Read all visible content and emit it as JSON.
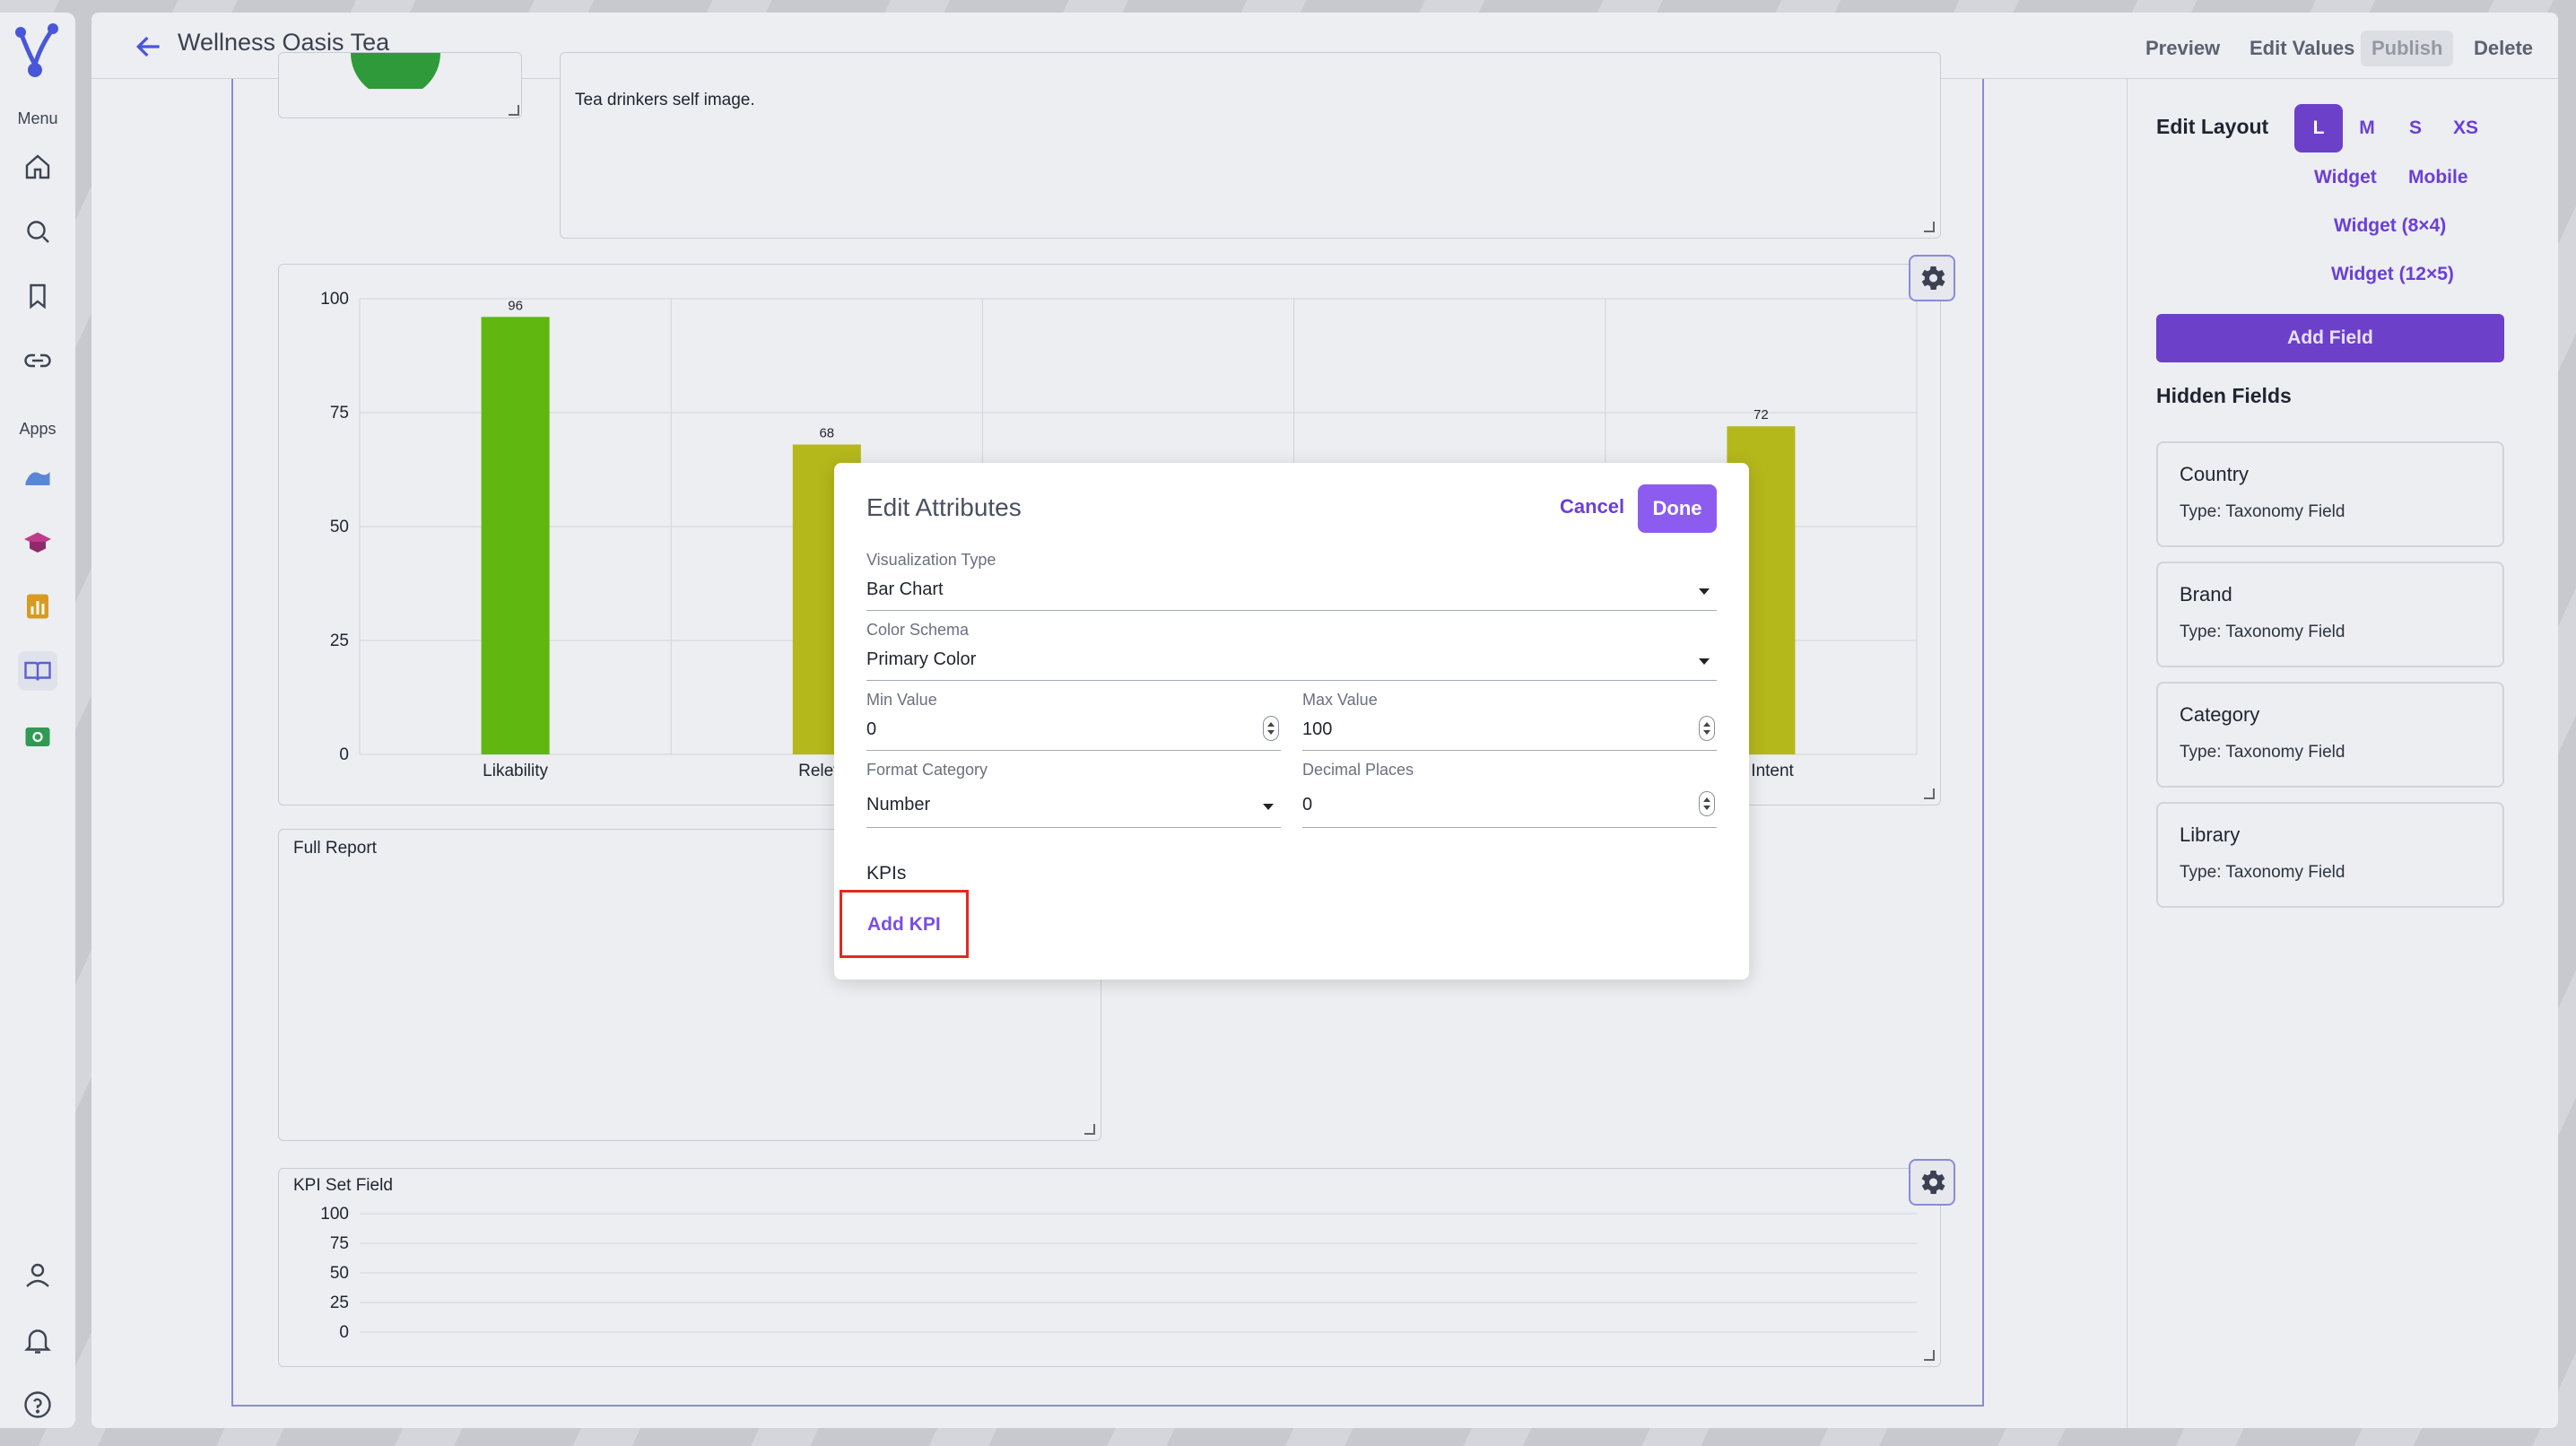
{
  "rail": {
    "menu_label": "Menu",
    "apps_label": "Apps"
  },
  "topbar": {
    "title": "Wellness Oasis Tea",
    "preview": "Preview",
    "edit_values": "Edit Values",
    "publish": "Publish",
    "delete": "Delete"
  },
  "canvas": {
    "text_panel_value": "Tea drinkers self image.",
    "full_report_label": "Full Report",
    "kpi_set_label": "KPI Set Field",
    "kpi_chart": {
      "ticks": [
        "100",
        "75",
        "50",
        "25",
        "0"
      ]
    }
  },
  "chart_data": [
    {
      "type": "bar",
      "categories": [
        "Likability",
        "Relevance",
        "",
        "",
        "Purchase Intent"
      ],
      "tick_labels": [
        "Likability",
        "Relevai",
        "",
        "",
        "se Intent"
      ],
      "values": [
        96,
        68,
        null,
        null,
        72
      ],
      "value_labels": [
        "96",
        "68",
        "",
        "",
        "72"
      ],
      "colors": [
        "#5fb70f",
        "#b5b81a",
        "",
        "",
        "#b5b81a"
      ],
      "ylim": [
        0,
        100
      ],
      "yticks": [
        "100",
        "75",
        "50",
        "25",
        "0"
      ],
      "grid": true
    }
  ],
  "sidebar": {
    "edit_layout": "Edit Layout",
    "sizes": [
      "L",
      "M",
      "S",
      "XS"
    ],
    "widget": "Widget",
    "mobile": "Mobile",
    "widget_8x4": "Widget (8×4)",
    "widget_12x5": "Widget (12×5)",
    "add_field": "Add Field",
    "hidden_fields_title": "Hidden Fields",
    "hidden_fields": [
      {
        "name": "Country",
        "type": "Type: Taxonomy Field"
      },
      {
        "name": "Brand",
        "type": "Type: Taxonomy Field"
      },
      {
        "name": "Category",
        "type": "Type: Taxonomy Field"
      },
      {
        "name": "Library",
        "type": "Type: Taxonomy Field"
      }
    ]
  },
  "modal": {
    "title": "Edit Attributes",
    "cancel": "Cancel",
    "done": "Done",
    "viz_type_label": "Visualization Type",
    "viz_type_value": "Bar Chart",
    "color_schema_label": "Color Schema",
    "color_schema_value": "Primary Color",
    "min_label": "Min Value",
    "min_value": "0",
    "max_label": "Max Value",
    "max_value": "100",
    "format_label": "Format Category",
    "format_value": "Number",
    "decimal_label": "Decimal Places",
    "decimal_value": "0",
    "kpis_label": "KPIs",
    "add_kpi": "Add KPI"
  }
}
